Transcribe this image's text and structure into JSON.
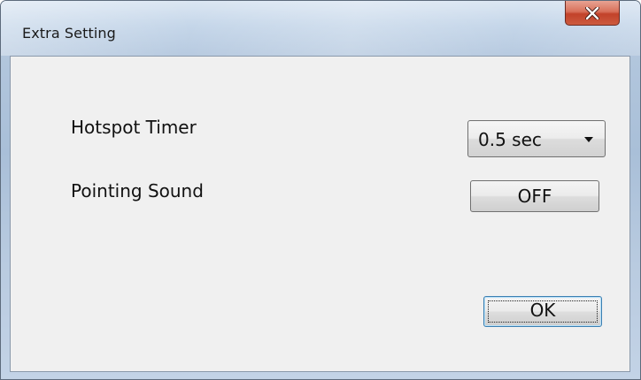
{
  "window": {
    "title": "Extra Setting"
  },
  "titlebar": {
    "close_icon": "close-x-icon"
  },
  "settings": {
    "hotspot_timer": {
      "label": "Hotspot Timer",
      "value": "0.5 sec"
    },
    "pointing_sound": {
      "label": "Pointing Sound",
      "value": "OFF"
    }
  },
  "actions": {
    "ok_label": "OK"
  },
  "colors": {
    "close_button": "#c2422a",
    "dialog_background": "#f0f0f0",
    "focus_border": "#3c7fb1"
  }
}
